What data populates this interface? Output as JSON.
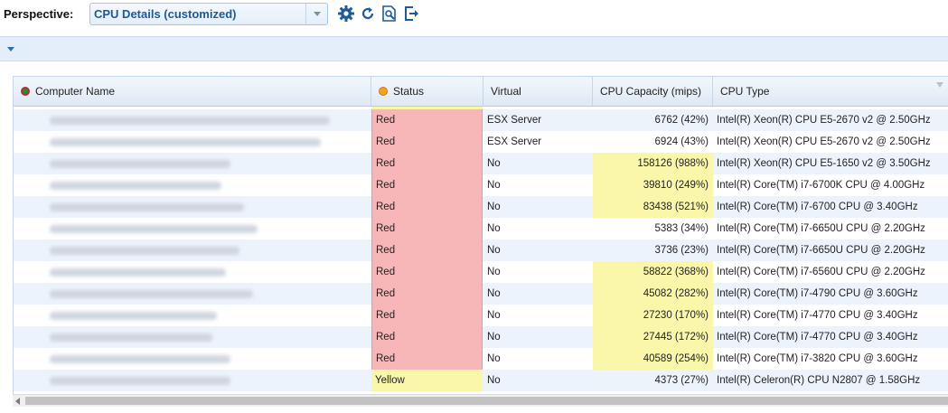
{
  "toolbar": {
    "perspective_label": "Perspective:",
    "perspective_value": "CPU Details (customized)",
    "icons": [
      "gear-icon",
      "refresh-icon",
      "search-document-icon",
      "export-icon"
    ]
  },
  "columns": {
    "computer_name": "Computer Name",
    "status": "Status",
    "virtual": "Virtual",
    "cpu_capacity": "CPU Capacity (mips)",
    "cpu_type": "CPU Type"
  },
  "colors": {
    "status_red": "#f7b7b9",
    "status_yellow": "#fbf7aa",
    "accent": "#1d5a95"
  },
  "rows": [
    {
      "status": "Red",
      "virtual": "ESX Server",
      "capacity": "6762 (42%)",
      "high": false,
      "cpu_type": "Intel(R) Xeon(R) CPU E5-2670 v2 @ 2.50GHz"
    },
    {
      "status": "Red",
      "virtual": "ESX Server",
      "capacity": "6924 (43%)",
      "high": false,
      "cpu_type": "Intel(R) Xeon(R) CPU E5-2670 v2 @ 2.50GHz"
    },
    {
      "status": "Red",
      "virtual": "No",
      "capacity": "158126 (988%)",
      "high": true,
      "cpu_type": "Intel(R) Xeon(R) CPU E5-1650 v2 @ 3.50GHz"
    },
    {
      "status": "Red",
      "virtual": "No",
      "capacity": "39810 (249%)",
      "high": true,
      "cpu_type": "Intel(R) Core(TM) i7-6700K CPU @ 4.00GHz"
    },
    {
      "status": "Red",
      "virtual": "No",
      "capacity": "83438 (521%)",
      "high": true,
      "cpu_type": "Intel(R) Core(TM) i7-6700 CPU @ 3.40GHz"
    },
    {
      "status": "Red",
      "virtual": "No",
      "capacity": "5383 (34%)",
      "high": false,
      "cpu_type": "Intel(R) Core(TM) i7-6650U CPU @ 2.20GHz"
    },
    {
      "status": "Red",
      "virtual": "No",
      "capacity": "3736 (23%)",
      "high": false,
      "cpu_type": "Intel(R) Core(TM) i7-6650U CPU @ 2.20GHz"
    },
    {
      "status": "Red",
      "virtual": "No",
      "capacity": "58822 (368%)",
      "high": true,
      "cpu_type": "Intel(R) Core(TM) i7-6560U CPU @ 2.20GHz"
    },
    {
      "status": "Red",
      "virtual": "No",
      "capacity": "45082 (282%)",
      "high": true,
      "cpu_type": "Intel(R) Core(TM) i7-4790 CPU @ 3.60GHz"
    },
    {
      "status": "Red",
      "virtual": "No",
      "capacity": "27230 (170%)",
      "high": true,
      "cpu_type": "Intel(R) Core(TM) i7-4770 CPU @ 3.40GHz"
    },
    {
      "status": "Red",
      "virtual": "No",
      "capacity": "27445 (172%)",
      "high": true,
      "cpu_type": "Intel(R) Core(TM) i7-4770 CPU @ 3.40GHz"
    },
    {
      "status": "Red",
      "virtual": "No",
      "capacity": "40589 (254%)",
      "high": true,
      "cpu_type": "Intel(R) Core(TM) i7-3820 CPU @ 3.60GHz"
    },
    {
      "status": "Yellow",
      "virtual": "No",
      "capacity": "4373 (27%)",
      "high": false,
      "cpu_type": "Intel(R) Celeron(R) CPU N2807 @ 1.58GHz"
    }
  ]
}
